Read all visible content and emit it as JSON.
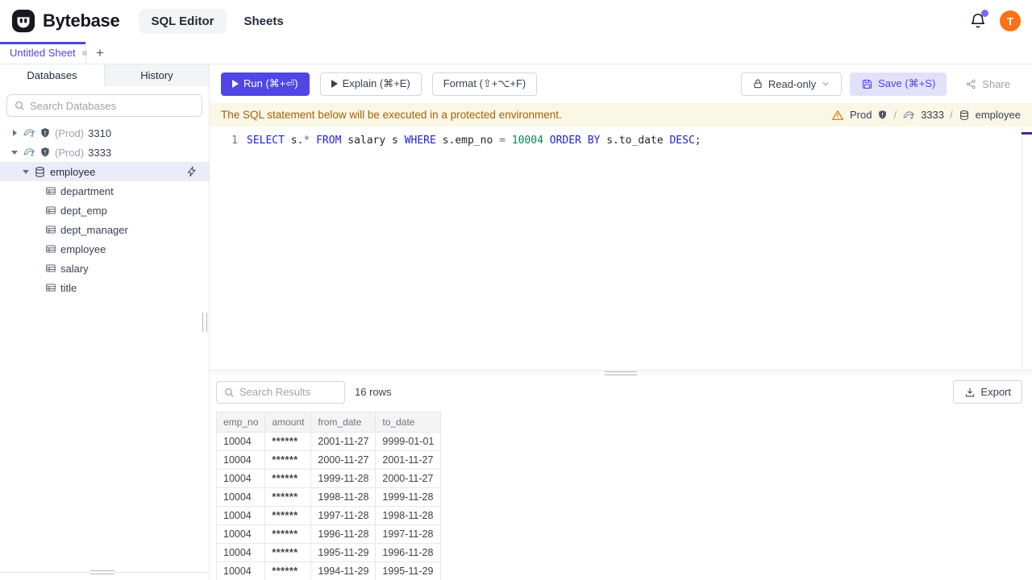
{
  "header": {
    "brand": "Bytebase",
    "nav_sql_editor": "SQL Editor",
    "nav_sheets": "Sheets",
    "avatar_letter": "T"
  },
  "sheetbar": {
    "tab_label": "Untitled Sheet",
    "new_tab": "+"
  },
  "sidebar": {
    "tab_databases": "Databases",
    "tab_history": "History",
    "search_placeholder": "Search Databases",
    "instances": [
      {
        "env": "(Prod)",
        "name": "3310"
      },
      {
        "env": "(Prod)",
        "name": "3333"
      }
    ],
    "database": "employee",
    "tables": [
      "department",
      "dept_emp",
      "dept_manager",
      "employee",
      "salary",
      "title"
    ]
  },
  "toolbar": {
    "run": "Run (⌘+⏎)",
    "explain": "Explain (⌘+E)",
    "format": "Format (⇧+⌥+F)",
    "readonly": "Read-only",
    "save": "Save (⌘+S)",
    "share": "Share"
  },
  "banner": {
    "message": "The SQL statement below will be executed in a protected environment.",
    "env": "Prod",
    "instance": "3333",
    "database": "employee"
  },
  "editor": {
    "line_number": "1",
    "tokens": [
      {
        "text": "SELECT",
        "type": "kw"
      },
      {
        "text": " s.",
        "type": "id"
      },
      {
        "text": "*",
        "type": "op"
      },
      {
        "text": " ",
        "type": "id"
      },
      {
        "text": "FROM",
        "type": "kw"
      },
      {
        "text": " salary s ",
        "type": "id"
      },
      {
        "text": "WHERE",
        "type": "kw"
      },
      {
        "text": " s.emp_no ",
        "type": "id"
      },
      {
        "text": "=",
        "type": "op"
      },
      {
        "text": " ",
        "type": "id"
      },
      {
        "text": "10004",
        "type": "num"
      },
      {
        "text": " ",
        "type": "id"
      },
      {
        "text": "ORDER",
        "type": "kw"
      },
      {
        "text": " ",
        "type": "id"
      },
      {
        "text": "BY",
        "type": "kw"
      },
      {
        "text": " s.to_date ",
        "type": "id"
      },
      {
        "text": "DESC",
        "type": "kw"
      },
      {
        "text": ";",
        "type": "id"
      }
    ]
  },
  "results": {
    "search_placeholder": "Search Results",
    "row_count": "16 rows",
    "export": "Export",
    "columns": [
      "emp_no",
      "amount",
      "from_date",
      "to_date"
    ],
    "rows": [
      [
        "10004",
        "******",
        "2001-11-27",
        "9999-01-01"
      ],
      [
        "10004",
        "******",
        "2000-11-27",
        "2001-11-27"
      ],
      [
        "10004",
        "******",
        "1999-11-28",
        "2000-11-27"
      ],
      [
        "10004",
        "******",
        "1998-11-28",
        "1999-11-28"
      ],
      [
        "10004",
        "******",
        "1997-11-28",
        "1998-11-28"
      ],
      [
        "10004",
        "******",
        "1996-11-28",
        "1997-11-28"
      ],
      [
        "10004",
        "******",
        "1995-11-29",
        "1996-11-28"
      ],
      [
        "10004",
        "******",
        "1994-11-29",
        "1995-11-29"
      ]
    ]
  },
  "colors": {
    "accent": "#4f46e5",
    "avatar": "#f97316",
    "banner_bg": "#fbf7e6",
    "banner_text": "#a16207",
    "sql_keyword": "#2323cf",
    "sql_number": "#098658",
    "selected_row_bg": "#ececf8"
  }
}
